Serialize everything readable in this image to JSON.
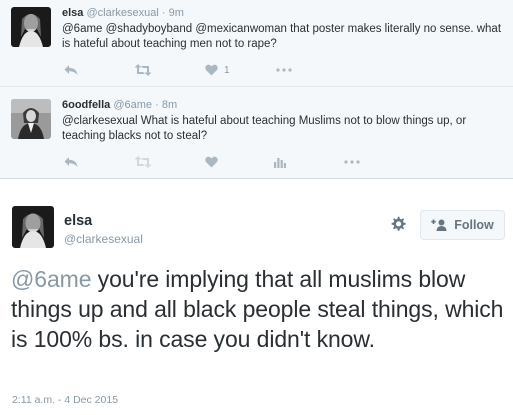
{
  "replies": [
    {
      "name": "elsa",
      "handle": "@clarkesexual",
      "separator": "·",
      "time": "9m",
      "text": "@6ame @shadyboyband @mexicanwoman that poster makes literally no sense. what is hateful about teaching men not to rape?",
      "like_count": "1",
      "icons": [
        "reply-icon",
        "retweet-icon",
        "heart-icon",
        "more-icon"
      ]
    },
    {
      "name": "6oodfella",
      "handle": "@6ame",
      "separator": "·",
      "time": "8m",
      "text": "@clarkesexual What is hateful about teaching Muslims not to blow things up, or teaching blacks not to steal?",
      "icons": [
        "reply-icon",
        "retweet-icon",
        "heart-icon",
        "analytics-icon",
        "more-icon"
      ]
    }
  ],
  "main_tweet": {
    "name": "elsa",
    "handle": "@clarkesexual",
    "follow_label": "Follow",
    "mention": "@6ame",
    "text": " you're implying that all muslims blow things up and all black people steal things, which is 100% bs. in case you didn't know.",
    "timestamp": "2:11 a.m. - 4 Dec 2015"
  },
  "colors": {
    "grey": "#8899a6",
    "icon": "#aab8c2",
    "text": "#292f33",
    "reply_bg": "#f5f8fa"
  }
}
